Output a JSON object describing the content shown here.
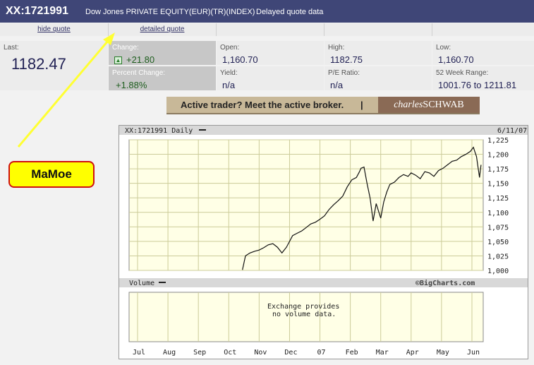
{
  "header": {
    "symbol": "XX:1721991",
    "description": "Dow Jones PRIVATE EQUITY(EUR)(TR)(INDEX)",
    "delay": "Delayed quote data"
  },
  "links": {
    "hide_quote": "hide quote",
    "detailed_quote": "detailed quote"
  },
  "quote": {
    "last_label": "Last:",
    "last_value": "1182.47",
    "change_label": "Change:",
    "change_value": "+21.80",
    "pct_label": "Percent Change:",
    "pct_value": "+1.88%",
    "open_label": "Open:",
    "open_value": "1,160.70",
    "yield_label": "Yield:",
    "yield_value": "n/a",
    "high_label": "High:",
    "high_value": "1182.75",
    "pe_label": "P/E Ratio:",
    "pe_value": "n/a",
    "low_label": "Low:",
    "low_value": "1,160.70",
    "range_label": "52 Week Range:",
    "range_value": "1001.76 to 1211.81"
  },
  "ad": {
    "text": "Active trader? Meet the active broker.",
    "separator": "|",
    "brand_italic": "charles",
    "brand_rest": "SCHWAB"
  },
  "callout": {
    "text": "MaMoe"
  },
  "colors": {
    "header_bg": "#3f4677",
    "plot_bg": "#ffffe6",
    "callout_bg": "#ffff00",
    "callout_border": "#d01010",
    "arrow": "#ffff33"
  },
  "chart_data": {
    "type": "line",
    "title": "XX:1721991 Daily",
    "date_label": "6/11/07",
    "ylim": [
      1000,
      1225
    ],
    "y_ticks": [
      1000,
      1025,
      1050,
      1075,
      1100,
      1125,
      1150,
      1175,
      1200,
      1225
    ],
    "y_tick_labels": [
      "1,000",
      "1,025",
      "1,050",
      "1,075",
      "1,100",
      "1,125",
      "1,150",
      "1,175",
      "1,200",
      "1,225"
    ],
    "x_tick_labels": [
      "Jul",
      "Aug",
      "Sep",
      "Oct",
      "Nov",
      "Dec",
      "07",
      "Feb",
      "Mar",
      "Apr",
      "May",
      "Jun"
    ],
    "x_tick_index": [
      0,
      1,
      2,
      3,
      4,
      5,
      6,
      7,
      8,
      9,
      10,
      11
    ],
    "volume_label": "Volume",
    "volume_note_line1": "Exchange provides",
    "volume_note_line2": "no volume data.",
    "source": "©BigCharts.com",
    "series": [
      {
        "x": [
          3.45,
          3.55,
          3.7,
          3.85,
          4.0,
          4.15,
          4.3,
          4.45,
          4.6,
          4.75,
          4.9,
          5.0,
          5.1,
          5.25,
          5.4,
          5.55,
          5.7,
          5.85,
          6.0,
          6.15,
          6.3,
          6.45,
          6.6,
          6.75,
          6.9,
          7.05,
          7.2,
          7.3,
          7.35,
          7.45,
          7.55,
          7.65,
          7.75,
          7.85,
          8.0,
          8.1,
          8.2,
          8.3,
          8.45,
          8.6,
          8.75,
          8.9,
          9.0,
          9.15,
          9.3,
          9.45,
          9.6,
          9.75,
          9.9,
          10.05,
          10.2,
          10.35,
          10.5,
          10.65,
          10.8,
          10.95,
          11.05,
          11.1,
          11.15,
          11.2,
          11.25,
          11.3
        ],
        "values": [
          1001,
          1025,
          1030,
          1033,
          1035,
          1039,
          1044,
          1046,
          1040,
          1030,
          1040,
          1050,
          1060,
          1064,
          1068,
          1074,
          1080,
          1083,
          1088,
          1094,
          1105,
          1113,
          1120,
          1128,
          1144,
          1156,
          1160,
          1170,
          1176,
          1178,
          1150,
          1125,
          1085,
          1115,
          1090,
          1118,
          1135,
          1148,
          1152,
          1160,
          1165,
          1162,
          1168,
          1164,
          1158,
          1170,
          1168,
          1162,
          1172,
          1176,
          1182,
          1188,
          1190,
          1196,
          1200,
          1205,
          1212,
          1204,
          1196,
          1178,
          1160,
          1182
        ]
      }
    ]
  }
}
